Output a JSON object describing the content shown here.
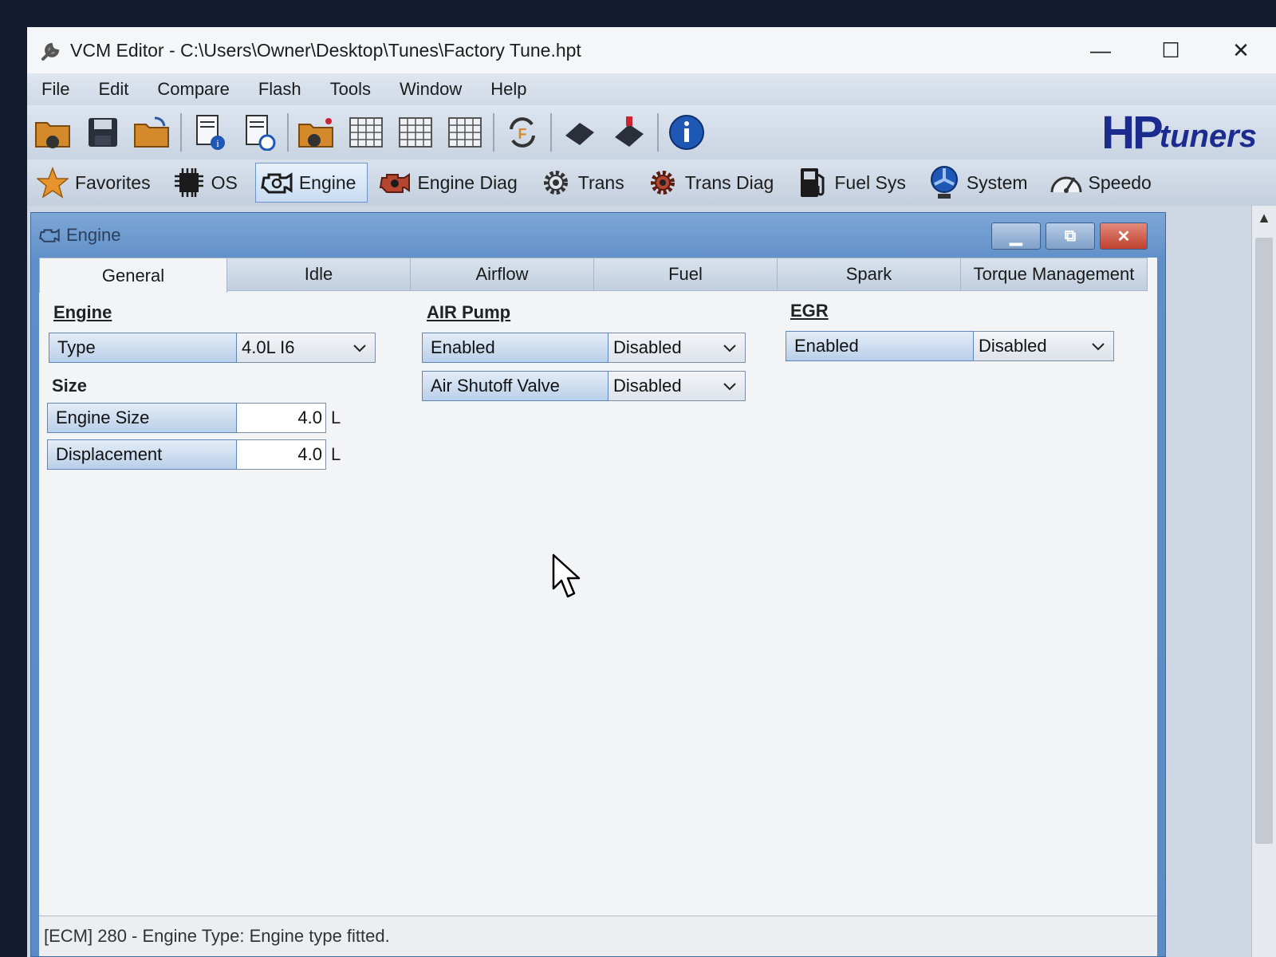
{
  "window": {
    "title": "VCM Editor - C:\\Users\\Owner\\Desktop\\Tunes\\Factory Tune.hpt",
    "controls": [
      "—",
      "☐",
      "✕"
    ]
  },
  "menu": [
    "File",
    "Edit",
    "Compare",
    "Flash",
    "Tools",
    "Window",
    "Help"
  ],
  "brand": {
    "hp": "HP",
    "tuners": "tuners",
    "color": "#1c2c8e"
  },
  "categories": [
    {
      "label": "Favorites",
      "icon": "star-icon"
    },
    {
      "label": "OS",
      "icon": "chip-icon"
    },
    {
      "label": "Engine",
      "icon": "engine-icon",
      "active": true
    },
    {
      "label": "Engine Diag",
      "icon": "engine-diag-icon"
    },
    {
      "label": "Trans",
      "icon": "gear-icon"
    },
    {
      "label": "Trans Diag",
      "icon": "gear-diag-icon"
    },
    {
      "label": "Fuel Sys",
      "icon": "fuel-pump-icon"
    },
    {
      "label": "System",
      "icon": "fan-icon"
    },
    {
      "label": "Speedo",
      "icon": "speedometer-icon"
    }
  ],
  "child": {
    "title": "Engine",
    "tabs": [
      "General",
      "Idle",
      "Airflow",
      "Fuel",
      "Spark",
      "Torque Management"
    ],
    "active_tab": "General"
  },
  "engine": {
    "heading": "Engine",
    "type_label": "Type",
    "type_value": "4.0L I6",
    "size_heading": "Size",
    "engine_size_label": "Engine Size",
    "engine_size_value": "4.0",
    "engine_size_unit": "L",
    "displacement_label": "Displacement",
    "displacement_value": "4.0",
    "displacement_unit": "L"
  },
  "air_pump": {
    "heading": "AIR Pump",
    "enabled_label": "Enabled",
    "enabled_value": "Disabled",
    "shutoff_label": "Air Shutoff Valve",
    "shutoff_value": "Disabled"
  },
  "egr": {
    "heading": "EGR",
    "enabled_label": "Enabled",
    "enabled_value": "Disabled"
  },
  "status": "[ECM] 280 - Engine Type: Engine type fitted."
}
